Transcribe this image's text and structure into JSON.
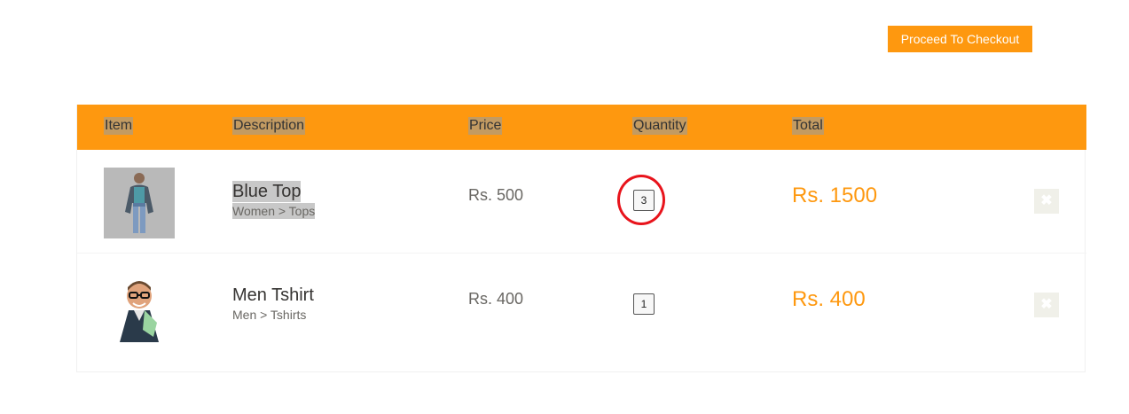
{
  "checkout_button": "Proceed To Checkout",
  "table": {
    "headers": {
      "item": "Item",
      "description": "Description",
      "price": "Price",
      "quantity": "Quantity",
      "total": "Total"
    },
    "rows": [
      {
        "name": "Blue Top",
        "category": "Women > Tops",
        "price": "Rs. 500",
        "quantity": "3",
        "total": "Rs. 1500",
        "delete_icon": "close-icon",
        "image": "product-image-blue-top"
      },
      {
        "name": "Men Tshirt",
        "category": "Men > Tshirts",
        "price": "Rs. 400",
        "quantity": "1",
        "total": "Rs. 400",
        "delete_icon": "close-icon",
        "image": "product-image-men-tshirt"
      }
    ]
  },
  "colors": {
    "accent": "#fe980f",
    "annotation": "#e8141c"
  }
}
